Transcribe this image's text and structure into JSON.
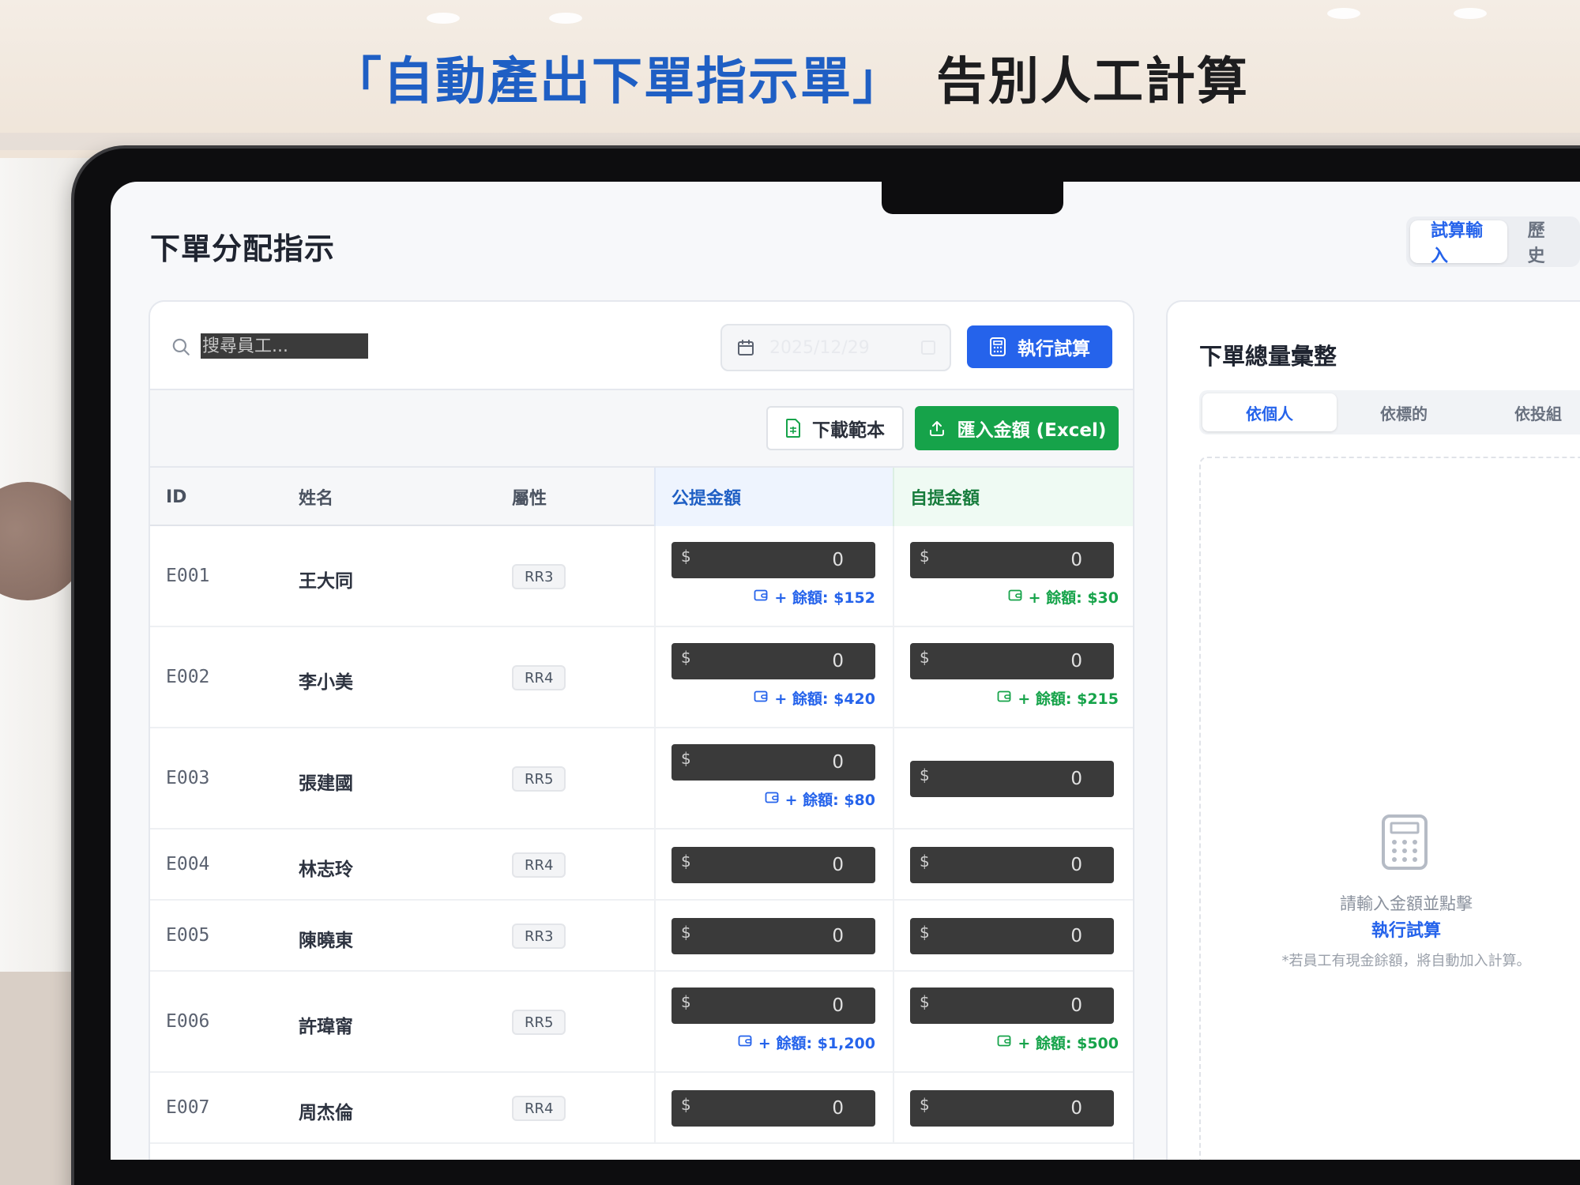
{
  "headline": {
    "blue": "「自動產出下單指示單」",
    "dark": "告別人工計算"
  },
  "app": {
    "title": "下單分配指示",
    "view_tabs": [
      "試算輸入",
      "歷史"
    ]
  },
  "search": {
    "placeholder": "搜尋員工..."
  },
  "date": {
    "value": "2025/12/29"
  },
  "buttons": {
    "run": "執行試算",
    "download_template": "下載範本",
    "import": "匯入金額 (Excel)"
  },
  "table": {
    "headers": {
      "id": "ID",
      "name": "姓名",
      "attr": "屬性",
      "public": "公提金額",
      "self": "自提金額"
    },
    "currency": "$",
    "rows": [
      {
        "id": "E001",
        "name": "王大同",
        "attr": "RR3",
        "public": "0",
        "self": "0",
        "public_remain": "+ 餘額: $152",
        "self_remain": "+ 餘額: $30"
      },
      {
        "id": "E002",
        "name": "李小美",
        "attr": "RR4",
        "public": "0",
        "self": "0",
        "public_remain": "+ 餘額: $420",
        "self_remain": "+ 餘額: $215"
      },
      {
        "id": "E003",
        "name": "張建國",
        "attr": "RR5",
        "public": "0",
        "self": "0",
        "public_remain": "+ 餘額: $80",
        "self_remain": ""
      },
      {
        "id": "E004",
        "name": "林志玲",
        "attr": "RR4",
        "public": "0",
        "self": "0",
        "public_remain": "",
        "self_remain": ""
      },
      {
        "id": "E005",
        "name": "陳曉東",
        "attr": "RR3",
        "public": "0",
        "self": "0",
        "public_remain": "",
        "self_remain": ""
      },
      {
        "id": "E006",
        "name": "許瑋甯",
        "attr": "RR5",
        "public": "0",
        "self": "0",
        "public_remain": "+ 餘額: $1,200",
        "self_remain": "+ 餘額: $500"
      },
      {
        "id": "E007",
        "name": "周杰倫",
        "attr": "RR4",
        "public": "0",
        "self": "0",
        "public_remain": "",
        "self_remain": ""
      }
    ]
  },
  "summary": {
    "title": "下單總量彙整",
    "tabs": [
      "依個人",
      "依標的",
      "依投組"
    ],
    "empty_line1": "請輸入金額並點擊",
    "empty_line2": "執行試算",
    "empty_note": "*若員工有現金餘額，將自動加入計算。"
  },
  "colors": {
    "accent": "#2563eb",
    "success": "#16a34a",
    "headline_blue": "#1f5fc4"
  }
}
